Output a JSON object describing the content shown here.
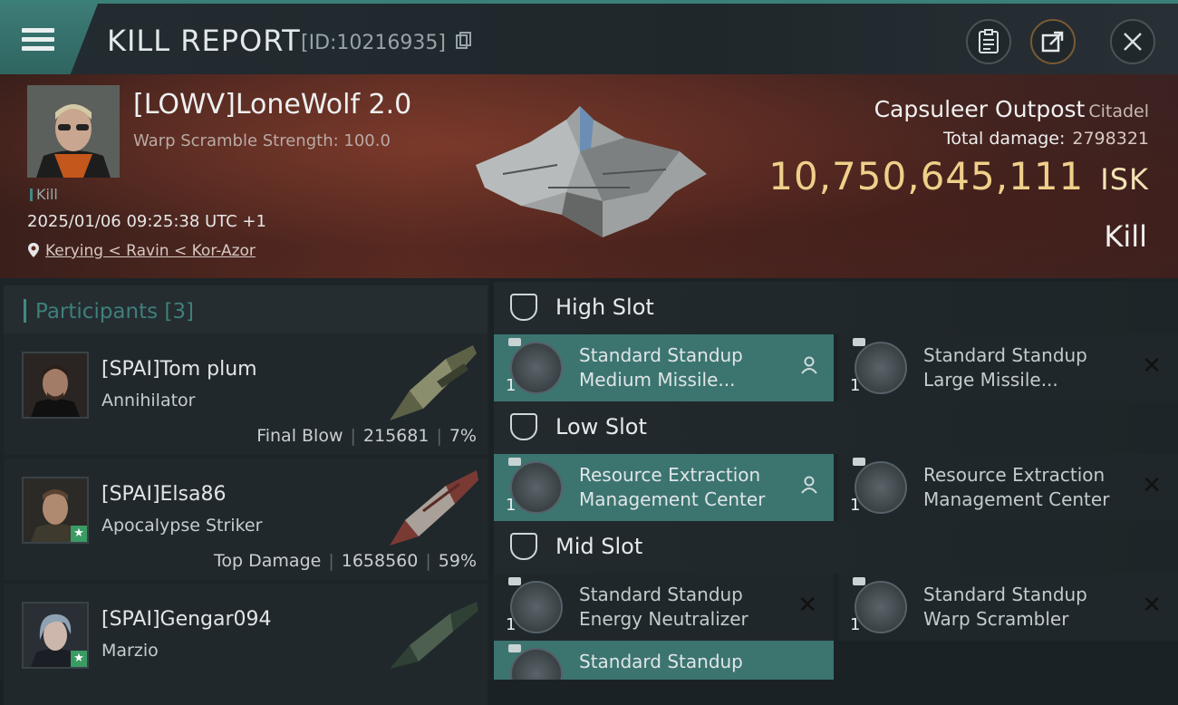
{
  "header": {
    "title": "KILL REPORT",
    "report_id": "[ID:10216935]"
  },
  "victim": {
    "name": "[LOWV]LoneWolf 2.0",
    "subtitle": "Warp Scramble Strength: 100.0",
    "kill_tag": "Kill",
    "timestamp": "2025/01/06 09:25:38 UTC +1",
    "location": "Kerying < Ravin < Kor-Azor"
  },
  "target": {
    "name": "Capsuleer Outpost",
    "type": "Citadel",
    "damage_label": "Total damage:",
    "damage_value": "2798321",
    "isk_value": "10,750,645,111",
    "isk_unit": "ISK",
    "result": "Kill"
  },
  "participants": {
    "label": "Participants",
    "count": "[3]",
    "rows": [
      {
        "name": "[SPAI]Tom plum",
        "ship": "Annihilator",
        "role": "Final Blow",
        "damage": "215681",
        "percent": "7%"
      },
      {
        "name": "[SPAI]Elsa86",
        "ship": "Apocalypse Striker",
        "role": "Top Damage",
        "damage": "1658560",
        "percent": "59%"
      },
      {
        "name": "[SPAI]Gengar094",
        "ship": "Marzio",
        "role": "",
        "damage": "",
        "percent": ""
      }
    ]
  },
  "slots": {
    "high": {
      "title": "High Slot",
      "modules": [
        {
          "line1": "Standard Standup",
          "line2": "Medium Missile...",
          "qty": "1",
          "status": "fitted"
        },
        {
          "line1": "Standard Standup",
          "line2": "Large Missile...",
          "qty": "1",
          "status": "destroyed"
        }
      ]
    },
    "low": {
      "title": "Low Slot",
      "modules": [
        {
          "line1": "Resource Extraction",
          "line2": "Management Center",
          "qty": "1",
          "status": "fitted"
        },
        {
          "line1": "Resource Extraction",
          "line2": "Management Center",
          "qty": "1",
          "status": "destroyed"
        }
      ]
    },
    "mid": {
      "title": "Mid Slot",
      "modules": [
        {
          "line1": "Standard Standup",
          "line2": "Energy Neutralizer",
          "qty": "1",
          "status": "destroyed"
        },
        {
          "line1": "Standard Standup",
          "line2": "Warp Scrambler",
          "qty": "1",
          "status": "destroyed"
        },
        {
          "line1": "Standard Standup",
          "line2": "",
          "qty": "",
          "status": "fitted"
        }
      ]
    }
  },
  "icons": {
    "menu": "menu-icon",
    "copy": "copy-icon",
    "clipboard": "clipboard-icon",
    "share": "share-icon",
    "close": "close-icon",
    "location": "location-pin-icon",
    "fitted": "pilot-icon",
    "destroyed": "x-icon"
  },
  "colors": {
    "accent": "#3c7470",
    "isk": "#efd08a"
  }
}
